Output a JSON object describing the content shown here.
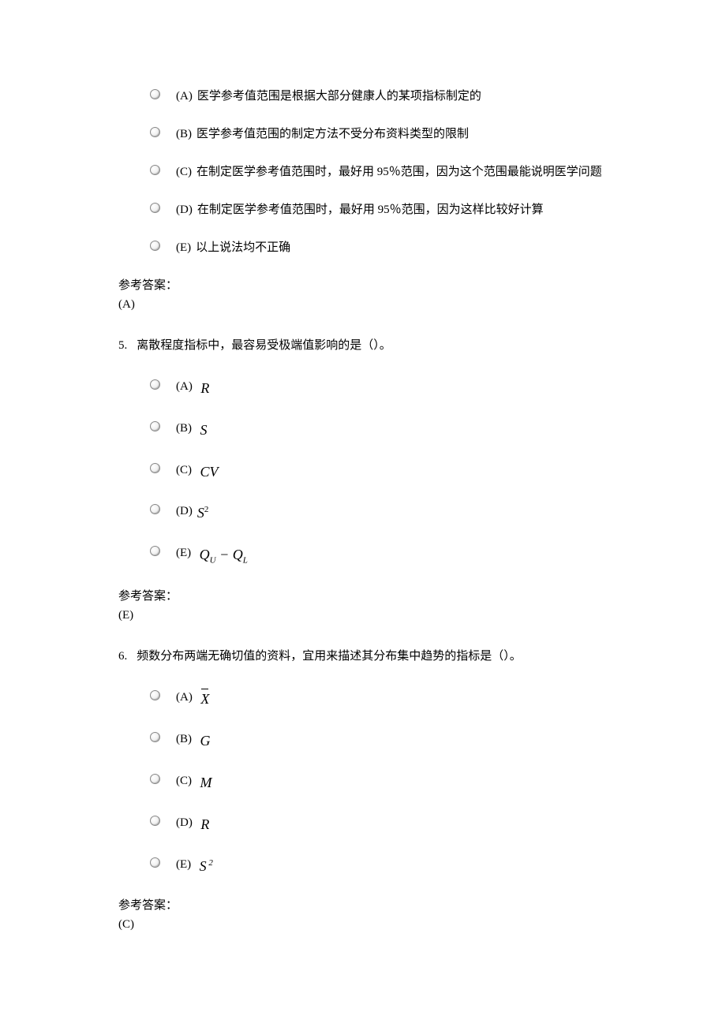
{
  "q4": {
    "options": {
      "a": {
        "label": "(A)",
        "text": "医学参考值范围是根据大部分健康人的某项指标制定的"
      },
      "b": {
        "label": "(B)",
        "text": "医学参考值范围的制定方法不受分布资料类型的限制"
      },
      "c": {
        "label": "(C)",
        "text": "在制定医学参考值范围时，最好用 95％范围，因为这个范围最能说明医学问题"
      },
      "d": {
        "label": "(D)",
        "text": "在制定医学参考值范围时，最好用 95％范围，因为这样比较好计算"
      },
      "e": {
        "label": "(E)",
        "text": "以上说法均不正确"
      }
    },
    "answer_label": "参考答案：",
    "answer_value": "(A)"
  },
  "q5": {
    "number": "5.",
    "text": "离散程度指标中，最容易受极端值影响的是（）。",
    "options": {
      "a": {
        "label": "(A)"
      },
      "b": {
        "label": "(B)"
      },
      "c": {
        "label": "(C)"
      },
      "d": {
        "label": "(D)"
      },
      "e": {
        "label": "(E)"
      }
    },
    "answer_label": "参考答案：",
    "answer_value": "(E)"
  },
  "q6": {
    "number": "6.",
    "text": "频数分布两端无确切值的资料，宜用来描述其分布集中趋势的指标是（）。",
    "options": {
      "a": {
        "label": "(A)"
      },
      "b": {
        "label": "(B)"
      },
      "c": {
        "label": "(C)"
      },
      "d": {
        "label": "(D)"
      },
      "e": {
        "label": "(E)"
      }
    },
    "answer_label": "参考答案：",
    "answer_value": "(C)"
  }
}
